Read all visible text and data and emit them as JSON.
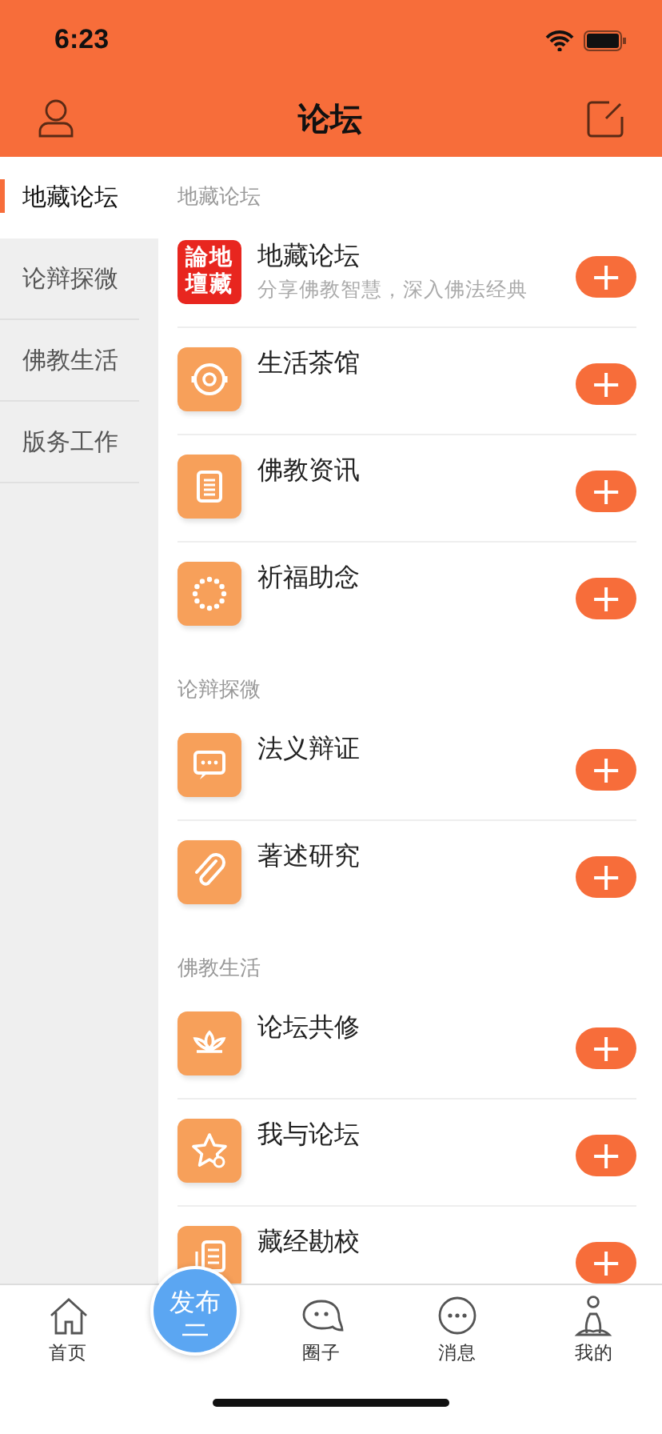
{
  "status_bar": {
    "time": "6:23"
  },
  "nav": {
    "title": "论坛"
  },
  "sidebar": {
    "items": [
      {
        "label": "地藏论坛",
        "selected": true
      },
      {
        "label": "论辩探微",
        "selected": false
      },
      {
        "label": "佛教生活",
        "selected": false
      },
      {
        "label": "版务工作",
        "selected": false
      }
    ]
  },
  "sections": [
    {
      "title": "地藏论坛",
      "items": [
        {
          "kind": "logo",
          "logo_text": "論地壇藏",
          "name": "地藏论坛",
          "subtitle": "分享佛教智慧，深入佛法经典"
        },
        {
          "kind": "icon",
          "name": "生活茶馆"
        },
        {
          "kind": "icon",
          "name": "佛教资讯"
        },
        {
          "kind": "icon",
          "name": "祈福助念"
        }
      ]
    },
    {
      "title": "论辩探微",
      "items": [
        {
          "kind": "icon",
          "name": "法义辩证"
        },
        {
          "kind": "icon",
          "name": "著述研究"
        }
      ]
    },
    {
      "title": "佛教生活",
      "items": [
        {
          "kind": "icon",
          "name": "论坛共修"
        },
        {
          "kind": "icon",
          "name": "我与论坛"
        },
        {
          "kind": "icon",
          "name": "藏经勘校"
        }
      ]
    }
  ],
  "add_button": {
    "label": "+"
  },
  "tab_bar": [
    {
      "kind": "tab",
      "label": "首页"
    },
    {
      "kind": "publish",
      "label": "发布"
    },
    {
      "kind": "tab",
      "label": "圈子"
    },
    {
      "kind": "tab",
      "label": "消息"
    },
    {
      "kind": "tab",
      "label": "我的"
    }
  ]
}
